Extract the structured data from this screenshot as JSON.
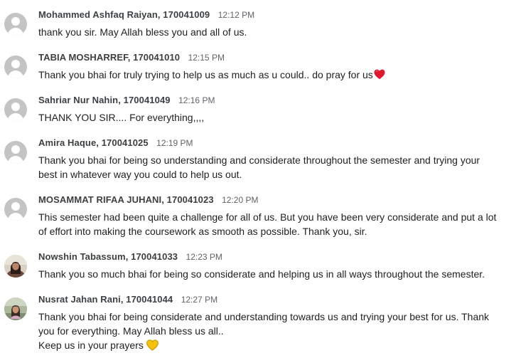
{
  "comments": [
    {
      "author": "Mohammed Ashfaq Raiyan, 170041009",
      "time": "12:12 PM",
      "text": "thank you sir. May Allah bless you and all of us."
    },
    {
      "author": "TABIA MOSHARREF, 170041010",
      "time": "12:15 PM",
      "text": "Thank you bhai for truly trying to help us as much as u could.. do pray for us",
      "emoji": "red-heart"
    },
    {
      "author": "Sahriar Nur Nahin, 170041049",
      "time": "12:16 PM",
      "text": "THANK YOU SIR.... For everything,,,,"
    },
    {
      "author": "Amira Haque, 170041025",
      "time": "12:19 PM",
      "text_lines": [
        "Thank you bhai for being so understanding and considerate throughout the semester and trying your",
        "best in whatever way you could to help us out."
      ]
    },
    {
      "author": "MOSAMMAT RIFAA JUHANI, 170041023",
      "time": "12:20 PM",
      "text_lines": [
        "This semester had been quite a challenge for all of us. But you have been very considerate and put a lot",
        "of effort into making the coursework as smooth as possible. Thank you, sir."
      ]
    },
    {
      "author": "Nowshin Tabassum, 170041033",
      "time": "12:23 PM",
      "text": "Thank you so much bhai for being so considerate and helping us in all ways throughout the semester.",
      "avatar": "photo"
    },
    {
      "author": "Nusrat Jahan Rani, 170041044",
      "time": "12:27 PM",
      "text_lines": [
        "Thank you bhai for being considerate and understanding towards us and trying your best for us. Thank",
        "you for everything. May Allah bless us all..",
        "Keep us in your prayers"
      ],
      "emoji": "yellow-heart",
      "avatar": "photo"
    }
  ],
  "colors": {
    "author": "#3c4043",
    "time": "#5f6368",
    "text": "#202124",
    "avatar_default": "#c4c4c4",
    "heart_red": "#e0182d",
    "heart_yellow": "#f4c20d"
  }
}
